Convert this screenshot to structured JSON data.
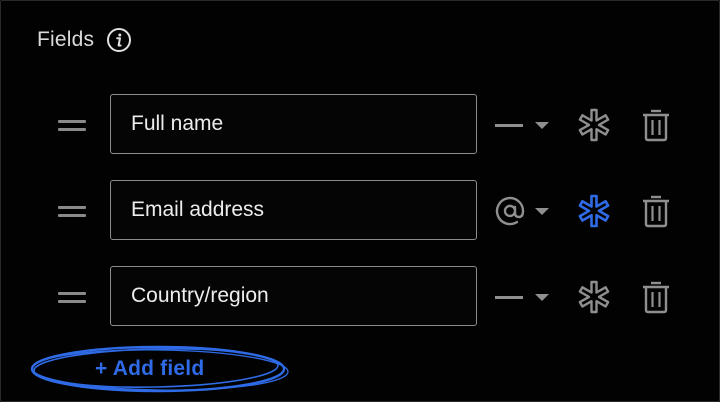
{
  "header": {
    "title": "Fields",
    "info_icon": "info-icon"
  },
  "fields": [
    {
      "value": "Full name",
      "type_icon": "dash-icon",
      "required": false
    },
    {
      "value": "Email address",
      "type_icon": "at-sign-icon",
      "required": true
    },
    {
      "value": "Country/region",
      "type_icon": "dash-icon",
      "required": false
    }
  ],
  "add_field_label": "+ Add field",
  "colors": {
    "accent": "#2f6be6",
    "icon_gray": "#8f8f8f",
    "border": "#8c8c8c",
    "background": "#020202"
  }
}
